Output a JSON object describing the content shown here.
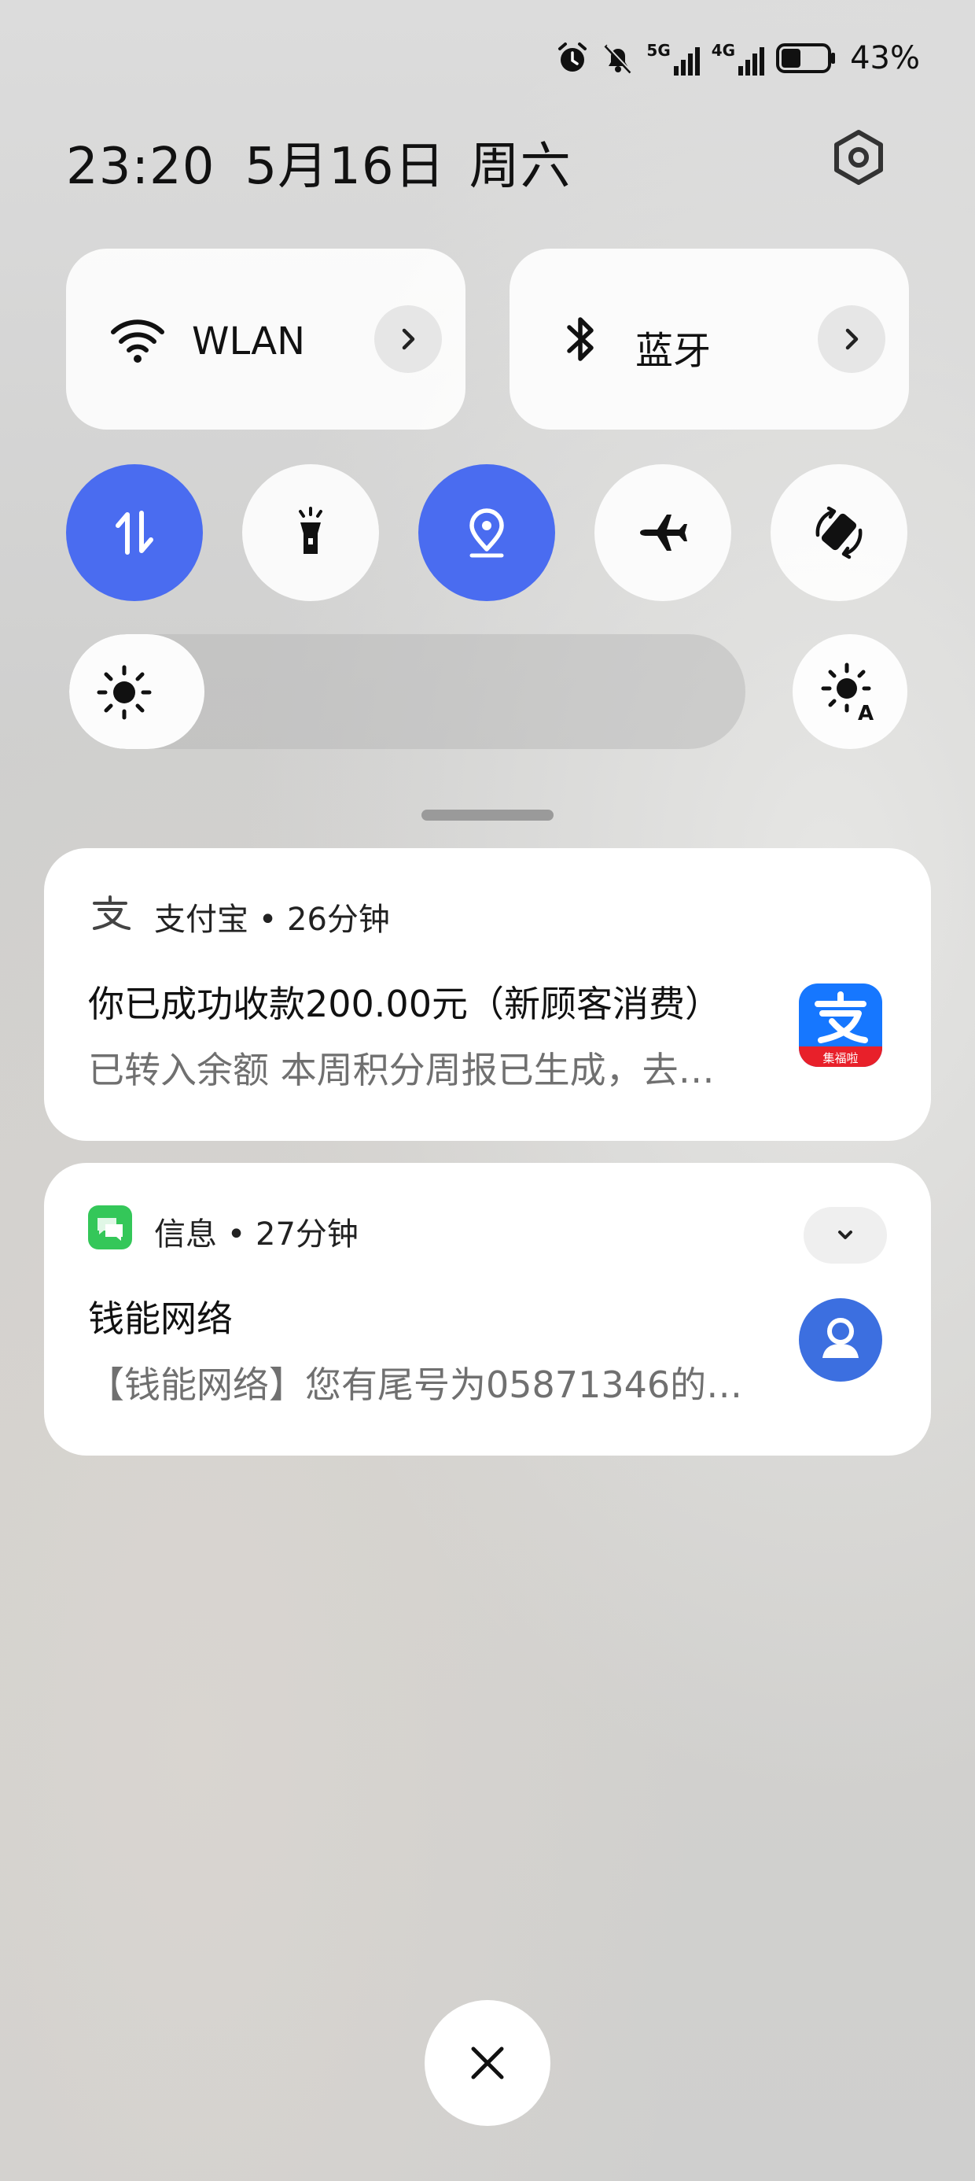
{
  "status_bar": {
    "signal_label_1": "5G",
    "signal_label_2": "4G",
    "battery_percent": "43%",
    "battery_level": 0.43
  },
  "header": {
    "time": "23:20",
    "date": "5月16日",
    "weekday": "周六"
  },
  "tiles": {
    "wlan": {
      "label": "WLAN",
      "icon": "wifi-icon"
    },
    "bluetooth": {
      "label": "蓝牙",
      "icon": "bluetooth-icon"
    }
  },
  "toggles": [
    {
      "name": "mobile-data",
      "icon": "data-arrows-icon",
      "on": true
    },
    {
      "name": "flashlight",
      "icon": "flashlight-icon",
      "on": false
    },
    {
      "name": "location",
      "icon": "location-icon",
      "on": true
    },
    {
      "name": "airplane-mode",
      "icon": "airplane-icon",
      "on": false
    },
    {
      "name": "auto-rotate",
      "icon": "rotate-icon",
      "on": false
    }
  ],
  "brightness": {
    "level": 0.2,
    "auto_label": "A"
  },
  "notifications": [
    {
      "app": "支付宝",
      "time": "26分钟",
      "title": "你已成功收款200.00元（新顾客消费）",
      "body": "已转入余额 本周积分周报已生成，去…",
      "thumb_badge": "集福啦"
    },
    {
      "app": "信息",
      "time": "27分钟",
      "title": "钱能网络",
      "body": "【钱能网络】您有尾号为05871346的…"
    }
  ],
  "colors": {
    "accent": "#4a6cf0",
    "alipay_blue": "#1677ff",
    "alipay_red": "#e8202a",
    "messages_green": "#34c759",
    "contact_blue": "#3c6fe0"
  }
}
